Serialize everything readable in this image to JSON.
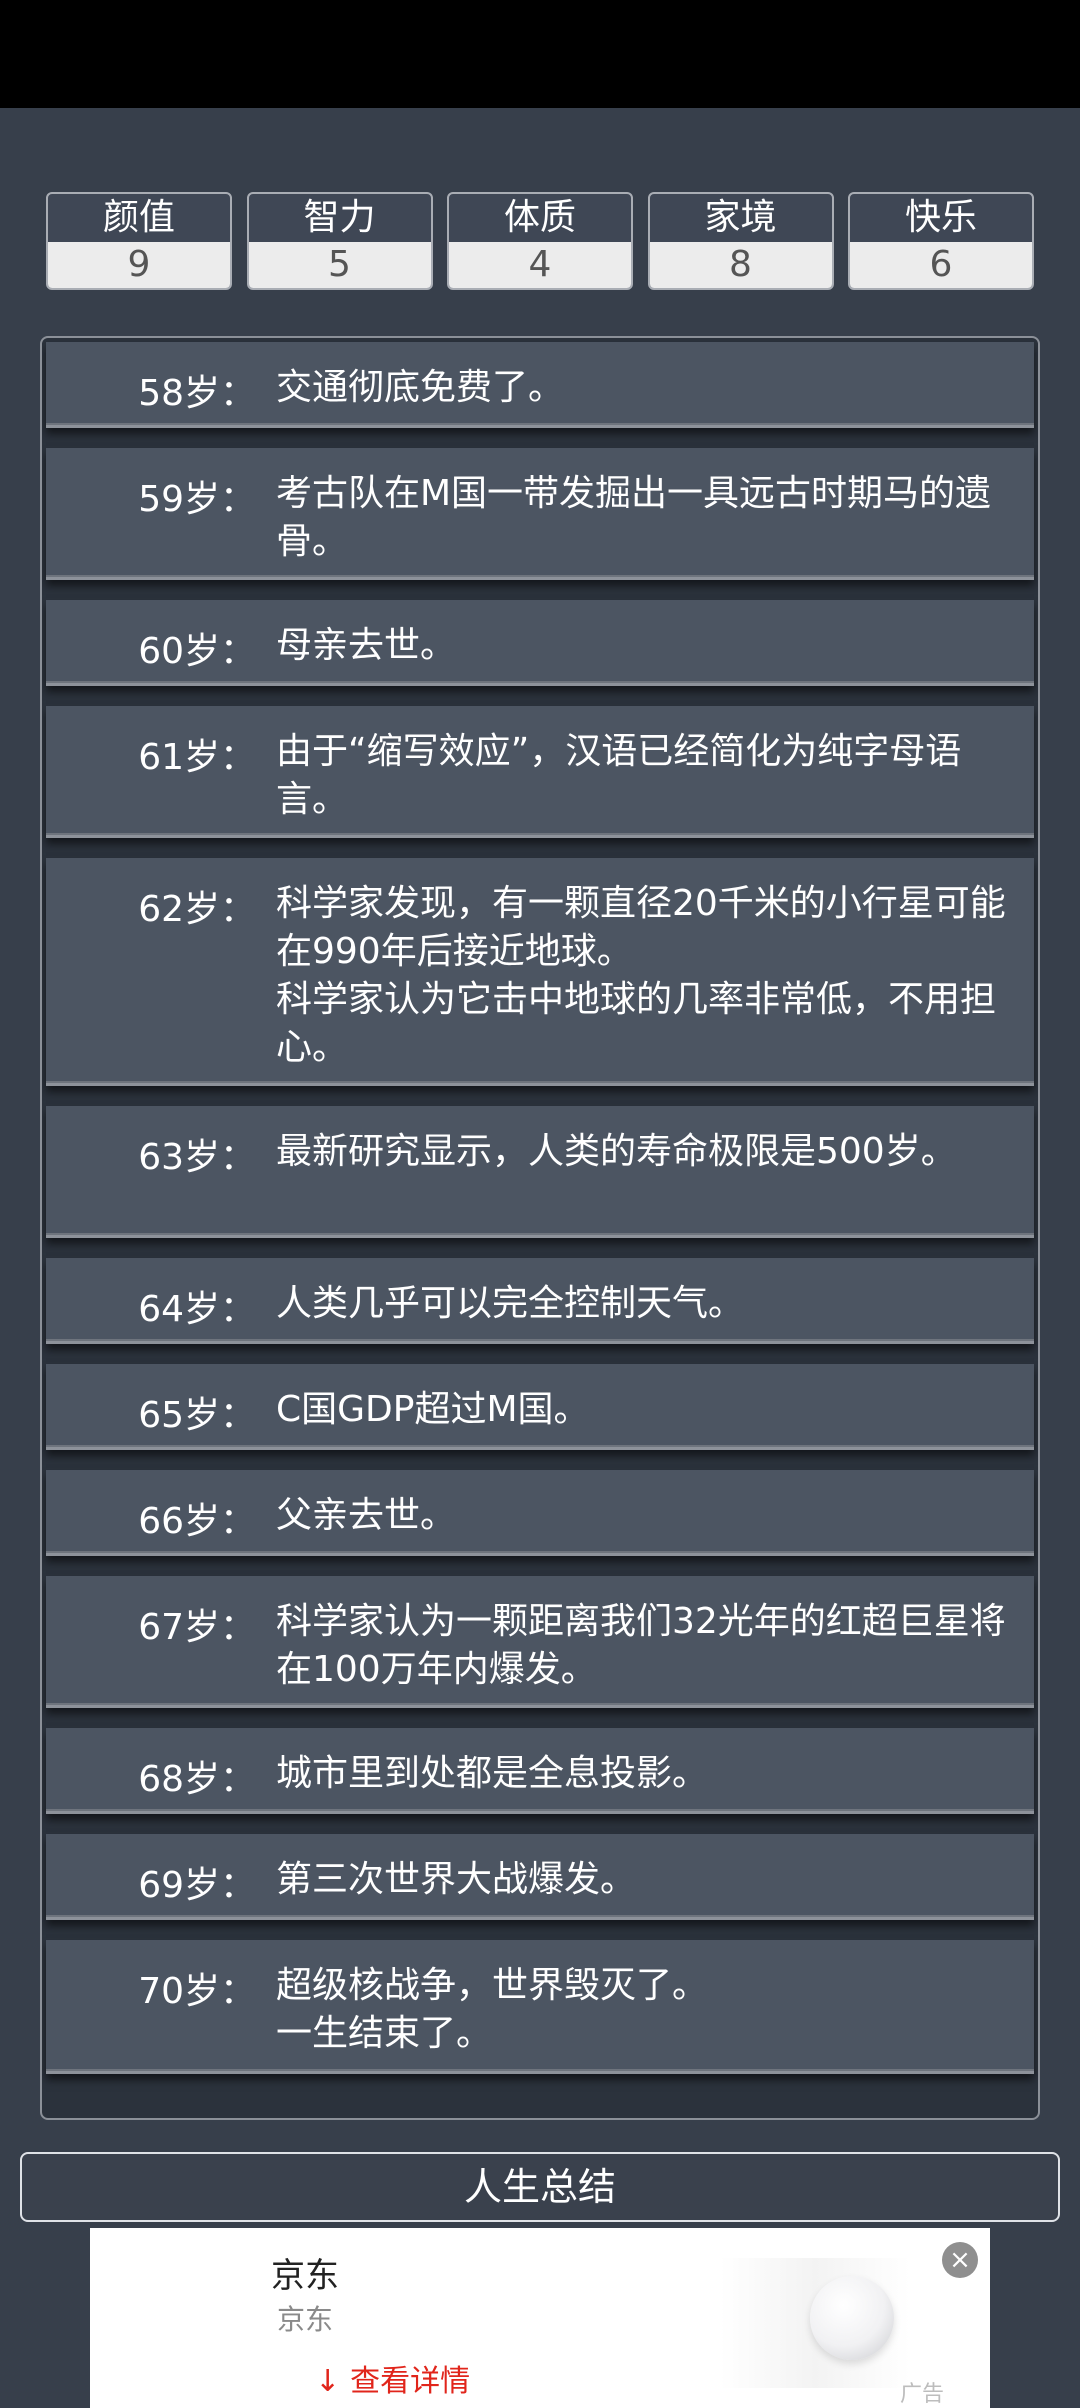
{
  "attributes": [
    {
      "label": "颜值",
      "value": "9"
    },
    {
      "label": "智力",
      "value": "5"
    },
    {
      "label": "体质",
      "value": "4"
    },
    {
      "label": "家境",
      "value": "8"
    },
    {
      "label": "快乐",
      "value": "6"
    }
  ],
  "events": [
    {
      "age": "58岁：",
      "lines": [
        "交通彻底免费了。"
      ]
    },
    {
      "age": "59岁：",
      "lines": [
        "考古队在M国一带发掘出一具远古时期马的遗骨。"
      ]
    },
    {
      "age": "60岁：",
      "lines": [
        "母亲去世。"
      ]
    },
    {
      "age": "61岁：",
      "lines": [
        "由于“缩写效应”，汉语已经简化为纯字母语言。"
      ]
    },
    {
      "age": "62岁：",
      "lines": [
        "科学家发现，有一颗直径20千米的小行星可能在990年后接近地球。",
        "科学家认为它击中地球的几率非常低，不用担心。"
      ]
    },
    {
      "age": "63岁：",
      "lines": [
        "最新研究显示，人类的寿命极限是500岁。"
      ]
    },
    {
      "age": "64岁：",
      "lines": [
        "人类几乎可以完全控制天气。"
      ]
    },
    {
      "age": "65岁：",
      "lines": [
        "C国GDP超过M国。"
      ]
    },
    {
      "age": "66岁：",
      "lines": [
        "父亲去世。"
      ]
    },
    {
      "age": "67岁：",
      "lines": [
        "科学家认为一颗距离我们32光年的红超巨星将在100万年内爆发。"
      ]
    },
    {
      "age": "68岁：",
      "lines": [
        "城市里到处都是全息投影。"
      ]
    },
    {
      "age": "69岁：",
      "lines": [
        "第三次世界大战爆发。"
      ]
    },
    {
      "age": "70岁：",
      "lines": [
        "超级核战争，世界毁灭了。",
        "一生结束了。"
      ]
    }
  ],
  "summary_button": "人生总结",
  "ad": {
    "title": "京东",
    "subtitle": "京东",
    "link": "查看详情",
    "tag": "广告",
    "close_icon": "close-icon",
    "link_icon": "download-arrow-icon"
  }
}
